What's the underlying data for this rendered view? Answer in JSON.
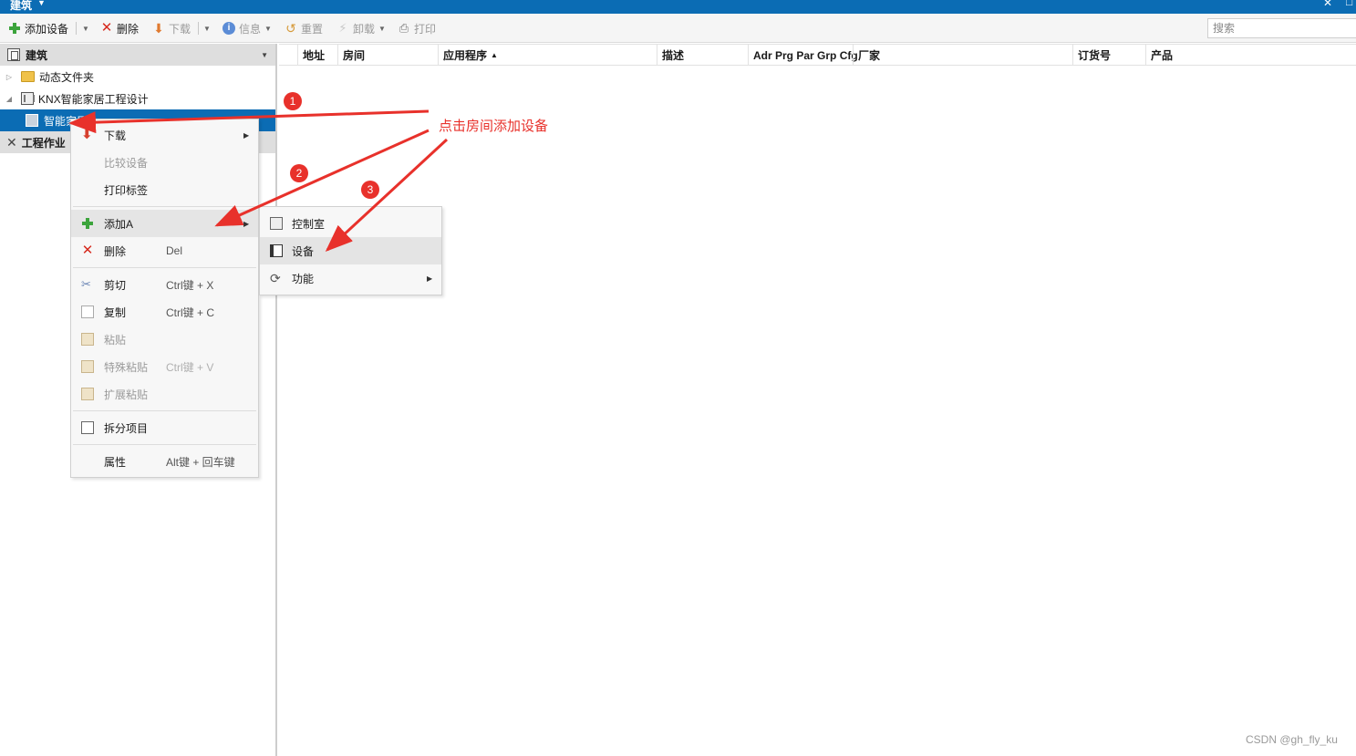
{
  "titlebar": {
    "title": "建筑"
  },
  "toolbar": {
    "add_device": "添加设备",
    "delete": "删除",
    "download": "下载",
    "info": "信息",
    "reset": "重置",
    "unload": "卸载",
    "print": "打印",
    "search_placeholder": "搜索"
  },
  "left_panel": {
    "header": "建筑",
    "tree": [
      {
        "label": "动态文件夹"
      },
      {
        "label": "KNX智能家居工程设计"
      },
      {
        "label": "智能家居"
      }
    ],
    "second_header": "工程作业"
  },
  "grid": {
    "columns": [
      "地址",
      "房间",
      "应用程序",
      "描述",
      "Adr Prg Par Grp Cfg",
      "厂家",
      "订货号",
      "产品"
    ]
  },
  "context_menu": {
    "items": [
      {
        "label": "下载",
        "shortcut": "",
        "submenu": true,
        "enabled": true
      },
      {
        "label": "比较设备",
        "shortcut": "",
        "enabled": false
      },
      {
        "label": "打印标签",
        "shortcut": "",
        "enabled": true
      },
      {
        "label": "添加A",
        "shortcut": "",
        "submenu": true,
        "enabled": true
      },
      {
        "label": "删除",
        "shortcut": "Del",
        "enabled": true
      },
      {
        "label": "剪切",
        "shortcut": "Ctrl键 + X",
        "enabled": true
      },
      {
        "label": "复制",
        "shortcut": "Ctrl键 + C",
        "enabled": true
      },
      {
        "label": "粘贴",
        "shortcut": "",
        "enabled": false
      },
      {
        "label": "特殊粘贴",
        "shortcut": "Ctrl键 + V",
        "enabled": false
      },
      {
        "label": "扩展粘贴",
        "shortcut": "",
        "enabled": false
      },
      {
        "label": "拆分项目",
        "shortcut": "",
        "enabled": true
      },
      {
        "label": "属性",
        "shortcut": "Alt键 + 回车键",
        "enabled": true
      }
    ]
  },
  "submenu": {
    "items": [
      {
        "label": "控制室"
      },
      {
        "label": "设备"
      },
      {
        "label": "功能"
      }
    ]
  },
  "annotation": {
    "text": "点击房间添加设备",
    "steps": [
      "1",
      "2",
      "3"
    ],
    "color": "#e8312b"
  },
  "watermark": "CSDN @gh_fly_ku"
}
